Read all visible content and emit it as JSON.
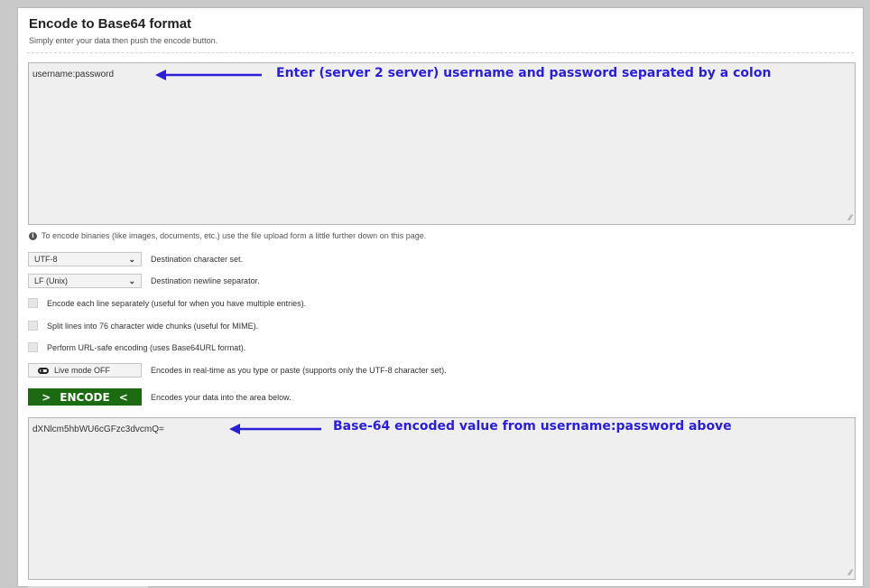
{
  "header": {
    "title": "Encode to Base64 format",
    "subtitle": "Simply enter your data then push the encode button."
  },
  "input": {
    "value": "username:password",
    "annotation": "Enter (server 2 server) username and password separated by a colon"
  },
  "info": {
    "text": "To encode binaries (like images, documents, etc.) use the file upload form a little further down on this page."
  },
  "options": {
    "charset": {
      "selected": "UTF-8",
      "label": "Destination character set."
    },
    "newline": {
      "selected": "LF (Unix)",
      "label": "Destination newline separator."
    },
    "each_line": "Encode each line separately (useful for when you have multiple entries).",
    "split_lines": "Split lines into 76 character wide chunks (useful for MIME).",
    "url_safe": "Perform URL-safe encoding (uses Base64URL format).",
    "live_mode": {
      "label": "Live mode OFF",
      "description": "Encodes in real-time as you type or paste (supports only the UTF-8 character set)."
    }
  },
  "encode": {
    "label": "ENCODE",
    "description": "Encodes your data into the area below."
  },
  "output": {
    "value": "dXNlcm5hbWU6cGFzc3dvcmQ=",
    "annotation": "Base-64 encoded value from username:password above"
  },
  "colors": {
    "annotation": "#2a1ed8",
    "encode_button": "#1c6b12"
  }
}
